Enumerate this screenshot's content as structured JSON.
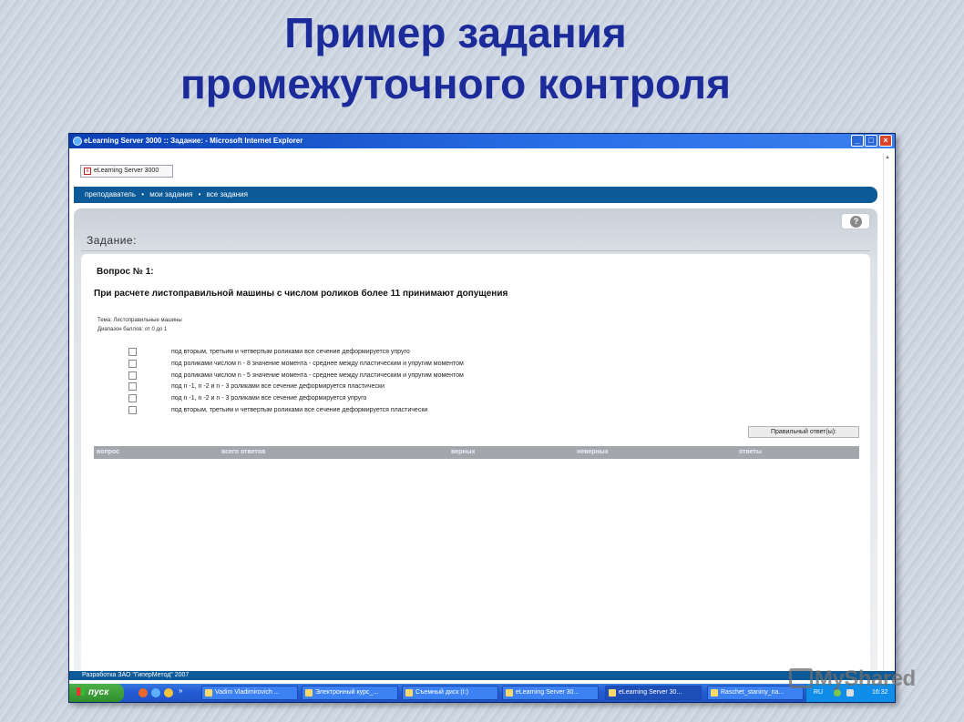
{
  "slide": {
    "title_line1": "Пример задания",
    "title_line2": "промежуточного контроля",
    "watermark": "MyShared"
  },
  "window": {
    "title": "eLearning Server 3000 :: Задание: - Microsoft Internet Explorer",
    "controls": [
      "_",
      "□",
      "×"
    ]
  },
  "tab": {
    "label": "eLearning Server 3000"
  },
  "nav": {
    "items": [
      "преподаватель",
      "мои задания",
      "все задания"
    ],
    "separator": "•"
  },
  "panel": {
    "title": "Задание:",
    "help_icon": "?"
  },
  "question": {
    "number": "Вопрос № 1:",
    "text": "При расчете листоправильной машины с числом роликов более 11 принимают допущения",
    "topic": "Тема: Листоправильные машины",
    "score_range": "Диапазон баллов: от 0 до 1",
    "answers": [
      "под вторым, третьим и четвертым роликами все сечение деформируется упруго",
      "под роликами числом n - 8 значение момента - среднее между пластическим и упругим моментом",
      "под роликами числом n - 5 значение момента - среднее между пластическим и упругим моментом",
      "под n -1, n -2  и n - 3 роликами все сечение деформируется пластически",
      "под n -1, n -2  и n - 3 роликами все сечение деформируется упруго",
      "под вторым, третьим и четвертым роликами все сечение деформируется пластически"
    ],
    "correct_button": "Правильный ответ(ы):"
  },
  "results_table": {
    "headers": [
      "вопрос",
      "всего ответов",
      "верных",
      "неверных",
      "ответы"
    ]
  },
  "footer": {
    "text": "Разработка ЗАО \"ГиперМетод\" 2007"
  },
  "taskbar": {
    "start": "пуск",
    "tasks": [
      "Vadim Vladimirovich ...",
      "Электронный курс_...",
      "Съемный диск (I:)",
      "eLearning Server 30...",
      "eLearning Server 30...",
      "Raschet_staniny_na..."
    ],
    "more": "»",
    "lang": "RU",
    "clock": "16:32"
  },
  "colors": {
    "title": "#1b2b99",
    "nav": "#0c5a98",
    "taskbar": "#245ed6",
    "start": "#2f8f2b"
  }
}
